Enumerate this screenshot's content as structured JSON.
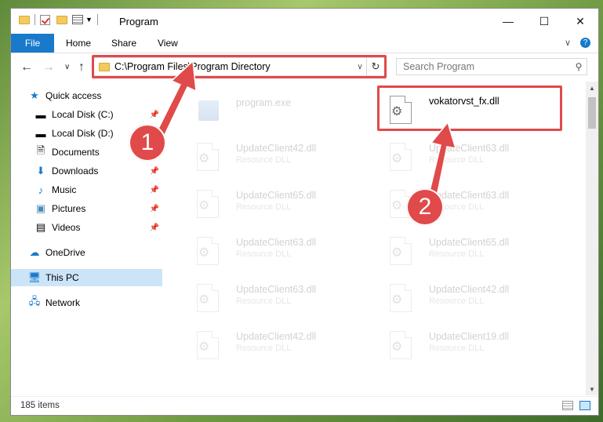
{
  "window": {
    "title": "Program",
    "controls": {
      "minimize": "—",
      "maximize": "☐",
      "close": "✕"
    }
  },
  "ribbon": {
    "tabs": [
      "File",
      "Home",
      "Share",
      "View"
    ],
    "expand": "∨",
    "help": "?"
  },
  "address": {
    "path": "C:\\Program Files\\Program Directory",
    "dropdown": "∨",
    "refresh": "↻"
  },
  "search": {
    "placeholder": "Search Program",
    "icon": "search-icon"
  },
  "nav_buttons": {
    "back": "←",
    "forward": "→",
    "recent": "∨",
    "up": "↑"
  },
  "navpane": {
    "items": [
      {
        "label": "Quick access",
        "icon": "star-icon",
        "pinned": false
      },
      {
        "label": "Local Disk (C:)",
        "icon": "drive-icon",
        "pinned": true
      },
      {
        "label": "Local Disk (D:)",
        "icon": "drive-icon",
        "pinned": true
      },
      {
        "label": "Documents",
        "icon": "documents-icon",
        "pinned": true
      },
      {
        "label": "Downloads",
        "icon": "downloads-icon",
        "pinned": true
      },
      {
        "label": "Music",
        "icon": "music-icon",
        "pinned": true
      },
      {
        "label": "Pictures",
        "icon": "pictures-icon",
        "pinned": true
      },
      {
        "label": "Videos",
        "icon": "videos-icon",
        "pinned": true
      },
      {
        "label": "OneDrive",
        "icon": "cloud-icon",
        "pinned": false
      },
      {
        "label": "This PC",
        "icon": "computer-icon",
        "pinned": false,
        "selected": true
      },
      {
        "label": "Network",
        "icon": "network-icon",
        "pinned": false
      }
    ]
  },
  "files": [
    {
      "name": "program.exe",
      "type": "",
      "faded": true
    },
    {
      "name": "vokatorvst_fx.dll",
      "type": "",
      "faded": false
    },
    {
      "name": "UpdateClient42.dll",
      "type": "Resource DLL",
      "faded": true
    },
    {
      "name": "UpdateClient63.dll",
      "type": "Resource DLL",
      "faded": true
    },
    {
      "name": "UpdateClient65.dll",
      "type": "Resource DLL",
      "faded": true
    },
    {
      "name": "UpdateClient63.dll",
      "type": "Resource DLL",
      "faded": true
    },
    {
      "name": "UpdateClient63.dll",
      "type": "Resource DLL",
      "faded": true
    },
    {
      "name": "UpdateClient65.dll",
      "type": "Resource DLL",
      "faded": true
    },
    {
      "name": "UpdateClient63.dll",
      "type": "Resource DLL",
      "faded": true
    },
    {
      "name": "UpdateClient42.dll",
      "type": "Resource DLL",
      "faded": true
    },
    {
      "name": "UpdateClient42.dll",
      "type": "Resource DLL",
      "faded": true
    },
    {
      "name": "UpdateClient19.dll",
      "type": "Resource DLL",
      "faded": true
    }
  ],
  "status": {
    "item_count": "185 items"
  },
  "annotations": {
    "step1": "1",
    "step2": "2"
  },
  "colors": {
    "accent": "#1979ca",
    "highlight": "#e04a4a",
    "selected": "#cce4f7"
  }
}
